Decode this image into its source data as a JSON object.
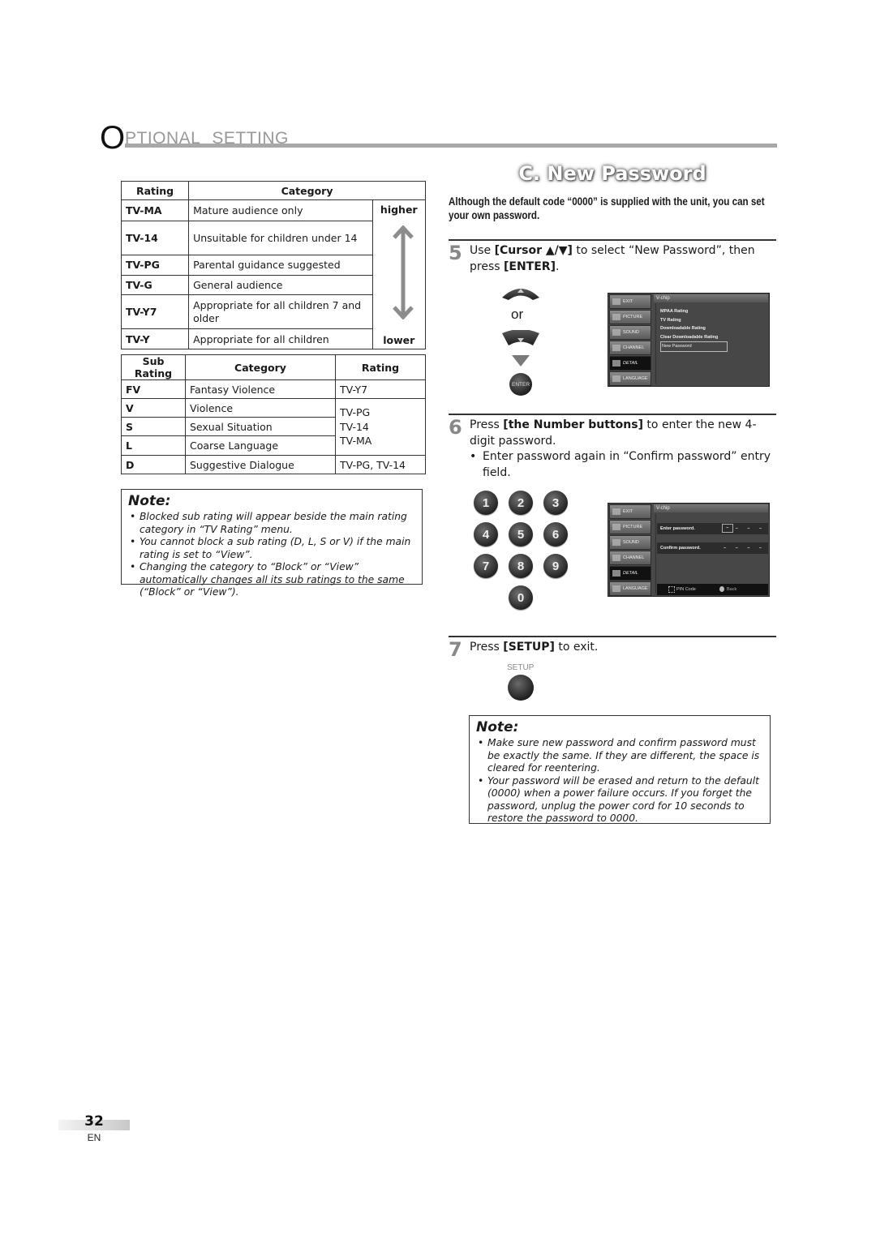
{
  "header": {
    "initial": "O",
    "rest_word1": "PTIONAL",
    "word2": "SETTING"
  },
  "rating_table": {
    "headers": [
      "Rating",
      "Category"
    ],
    "rows": [
      {
        "rating": "TV-MA",
        "category": "Mature audience only"
      },
      {
        "rating": "TV-14",
        "category": "Unsuitable for children under 14"
      },
      {
        "rating": "TV-PG",
        "category": "Parental guidance suggested"
      },
      {
        "rating": "TV-G",
        "category": "General audience"
      },
      {
        "rating": "TV-Y7",
        "category": "Appropriate for all children 7 and older"
      },
      {
        "rating": "TV-Y",
        "category": "Appropriate for all children"
      }
    ],
    "higher_label": "higher",
    "lower_label": "lower"
  },
  "subrating_table": {
    "headers": [
      "Sub Rating",
      "Category",
      "Rating"
    ],
    "rows": [
      {
        "sub": "FV",
        "category": "Fantasy Violence"
      },
      {
        "sub": "V",
        "category": "Violence"
      },
      {
        "sub": "S",
        "category": "Sexual Situation"
      },
      {
        "sub": "L",
        "category": "Coarse Language"
      },
      {
        "sub": "D",
        "category": "Suggestive Dialogue"
      }
    ],
    "rating_groups": [
      "TV-Y7",
      "TV-PG\nTV-14\nTV-MA",
      "TV-PG, TV-14"
    ]
  },
  "note1": {
    "title": "Note:",
    "items": [
      "Blocked sub rating will appear beside the main rating category in “TV Rating” menu.",
      "You cannot block a sub rating (D, L, S or V) if the main rating is set to “View”.",
      "Changing the category to “Block” or “View” automatically changes all its sub ratings to the same (“Block” or “View”)."
    ]
  },
  "section": {
    "title": "C.  New Password",
    "intro": "Although the default code “0000” is supplied with the unit, you can set your own password."
  },
  "step5": {
    "num": "5",
    "pre": "Use ",
    "bold1": "[Cursor ▲/▼]",
    "mid": " to select “New Password”, then press ",
    "bold2": "[ENTER]",
    "post": ".",
    "or_label": "or",
    "enter_label": "ENTER"
  },
  "tv_menu_sidebar": [
    "EXIT",
    "PICTURE",
    "SOUND",
    "CHANNEL",
    "DETAIL",
    "LANGUAGE"
  ],
  "tv_menu1": {
    "title": "V-chip",
    "items": [
      "MPAA Rating",
      "TV Rating",
      "Downloadable Rating",
      "Clear Downloadable Rating",
      "New Password"
    ],
    "selected": "New Password"
  },
  "step6": {
    "num": "6",
    "pre": "Press ",
    "bold": "[the Number buttons]",
    "post": " to enter the new 4-digit password.",
    "bullet": "Enter password again in “Confirm password” entry field.",
    "keys": [
      "1",
      "2",
      "3",
      "4",
      "5",
      "6",
      "7",
      "8",
      "9",
      "0"
    ]
  },
  "tv_menu2": {
    "title": "V-chip",
    "enter_label": "Enter password.",
    "confirm_label": "Confirm password.",
    "enter_value": "– – – –",
    "confirm_value": "– – – –",
    "footer_pin": "PIN Code",
    "footer_back": "Back"
  },
  "step7": {
    "num": "7",
    "pre": "Press ",
    "bold": "[SETUP]",
    "post": " to exit.",
    "setup_label": "SETUP"
  },
  "note2": {
    "title": "Note:",
    "items": [
      "Make sure new password and confirm password must be exactly the same. If they are different, the space is cleared for reentering.",
      "Your password will be erased and return to the default (0000) when a power failure occurs. If you forget the password, unplug the power cord for 10 seconds to restore the password to 0000."
    ]
  },
  "footer": {
    "page_number": "32",
    "lang": "EN"
  }
}
